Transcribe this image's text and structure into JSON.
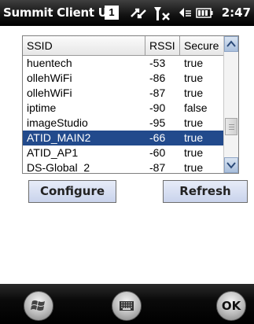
{
  "titlebar": {
    "title": "Summit Client Uti",
    "badge": "1",
    "clock": "2:47",
    "icons": [
      "connectivity-icon",
      "signal-off-icon",
      "volume-icon",
      "battery-icon"
    ]
  },
  "list": {
    "columns": [
      "SSID",
      "RSSI",
      "Secure"
    ],
    "rows": [
      {
        "ssid": "huentech",
        "rssi": "-53",
        "secure": "true"
      },
      {
        "ssid": "ollehWiFi",
        "rssi": "-86",
        "secure": "true"
      },
      {
        "ssid": "ollehWiFi",
        "rssi": "-87",
        "secure": "true"
      },
      {
        "ssid": "iptime",
        "rssi": "-90",
        "secure": "false"
      },
      {
        "ssid": "imageStudio",
        "rssi": "-95",
        "secure": "true"
      },
      {
        "ssid": "ATID_MAIN2",
        "rssi": "-66",
        "secure": "true",
        "selected": true
      },
      {
        "ssid": "ATID_AP1",
        "rssi": "-60",
        "secure": "true"
      },
      {
        "ssid": "DS-Global_2",
        "rssi": "-87",
        "secure": "true"
      }
    ]
  },
  "buttons": {
    "configure": "Configure",
    "refresh": "Refresh"
  },
  "bottombar": {
    "ok": "OK",
    "icons": [
      "windows-start-icon",
      "keyboard-icon"
    ]
  },
  "colors": {
    "selection": "#224a8c",
    "titlebar": "#000000"
  }
}
